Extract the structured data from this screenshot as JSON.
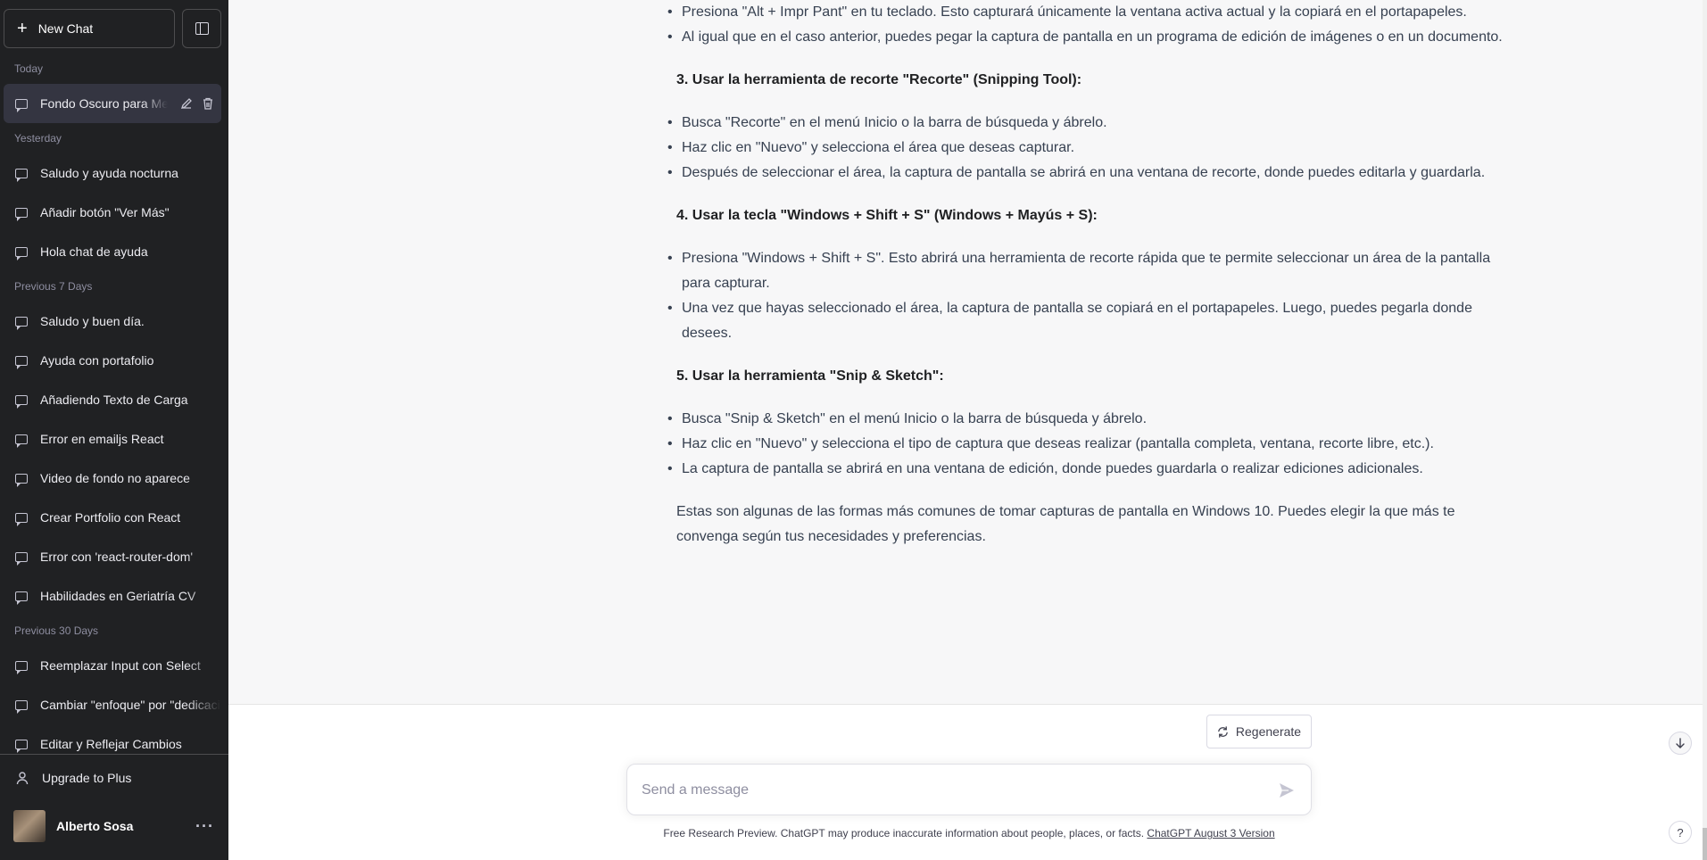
{
  "sidebar": {
    "new_chat_label": "New Chat",
    "groups": [
      {
        "label": "Today",
        "items": [
          {
            "title": "Fondo Oscuro para Menú",
            "active": true
          }
        ]
      },
      {
        "label": "Yesterday",
        "items": [
          {
            "title": "Saludo y ayuda nocturna"
          },
          {
            "title": "Añadir botón \"Ver Más\""
          },
          {
            "title": "Hola chat de ayuda"
          }
        ]
      },
      {
        "label": "Previous 7 Days",
        "items": [
          {
            "title": "Saludo y buen día."
          },
          {
            "title": "Ayuda con portafolio"
          },
          {
            "title": "Añadiendo Texto de Carga"
          },
          {
            "title": "Error en emailjs React"
          },
          {
            "title": "Video de fondo no aparece"
          },
          {
            "title": "Crear Portfolio con React"
          },
          {
            "title": "Error con 'react-router-dom'"
          },
          {
            "title": "Habilidades en Geriatría CV"
          }
        ]
      },
      {
        "label": "Previous 30 Days",
        "items": [
          {
            "title": "Reemplazar Input con Select"
          },
          {
            "title": "Cambiar \"enfoque\" por \"dedicación\""
          },
          {
            "title": "Editar y Reflejar Cambios"
          }
        ]
      }
    ],
    "upgrade_label": "Upgrade to Plus",
    "user_name": "Alberto Sosa",
    "more_label": "···"
  },
  "message": {
    "intro_bullets": [
      "Presiona \"Alt + Impr Pant\" en tu teclado. Esto capturará únicamente la ventana activa actual y la copiará en el portapapeles.",
      "Al igual que en el caso anterior, puedes pegar la captura de pantalla en un programa de edición de imágenes o en un documento."
    ],
    "sections": [
      {
        "heading": "3. Usar la herramienta de recorte \"Recorte\" (Snipping Tool):",
        "bullets": [
          "Busca \"Recorte\" en el menú Inicio o la barra de búsqueda y ábrelo.",
          "Haz clic en \"Nuevo\" y selecciona el área que deseas capturar.",
          "Después de seleccionar el área, la captura de pantalla se abrirá en una ventana de recorte, donde puedes editarla y guardarla."
        ]
      },
      {
        "heading": "4. Usar la tecla \"Windows + Shift + S\" (Windows + Mayús + S):",
        "bullets": [
          "Presiona \"Windows + Shift + S\". Esto abrirá una herramienta de recorte rápida que te permite seleccionar un área de la pantalla para capturar.",
          "Una vez que hayas seleccionado el área, la captura de pantalla se copiará en el portapapeles. Luego, puedes pegarla donde desees."
        ]
      },
      {
        "heading": "5. Usar la herramienta \"Snip & Sketch\":",
        "bullets": [
          "Busca \"Snip & Sketch\" en el menú Inicio o la barra de búsqueda y ábrelo.",
          "Haz clic en \"Nuevo\" y selecciona el tipo de captura que deseas realizar (pantalla completa, ventana, recorte libre, etc.).",
          "La captura de pantalla se abrirá en una ventana de edición, donde puedes guardarla o realizar ediciones adicionales."
        ]
      }
    ],
    "closing": "Estas son algunas de las formas más comunes de tomar capturas de pantalla en Windows 10. Puedes elegir la que más te convenga según tus necesidades y preferencias."
  },
  "composer": {
    "regenerate_label": "Regenerate",
    "placeholder": "Send a message",
    "footer_text": "Free Research Preview. ChatGPT may produce inaccurate information about people, places, or facts. ",
    "footer_link": "ChatGPT August 3 Version",
    "help_label": "?"
  },
  "colors": {
    "sidebar_bg": "#202123",
    "content_bg": "#f7f7f8",
    "top_line": "#d9363e"
  }
}
